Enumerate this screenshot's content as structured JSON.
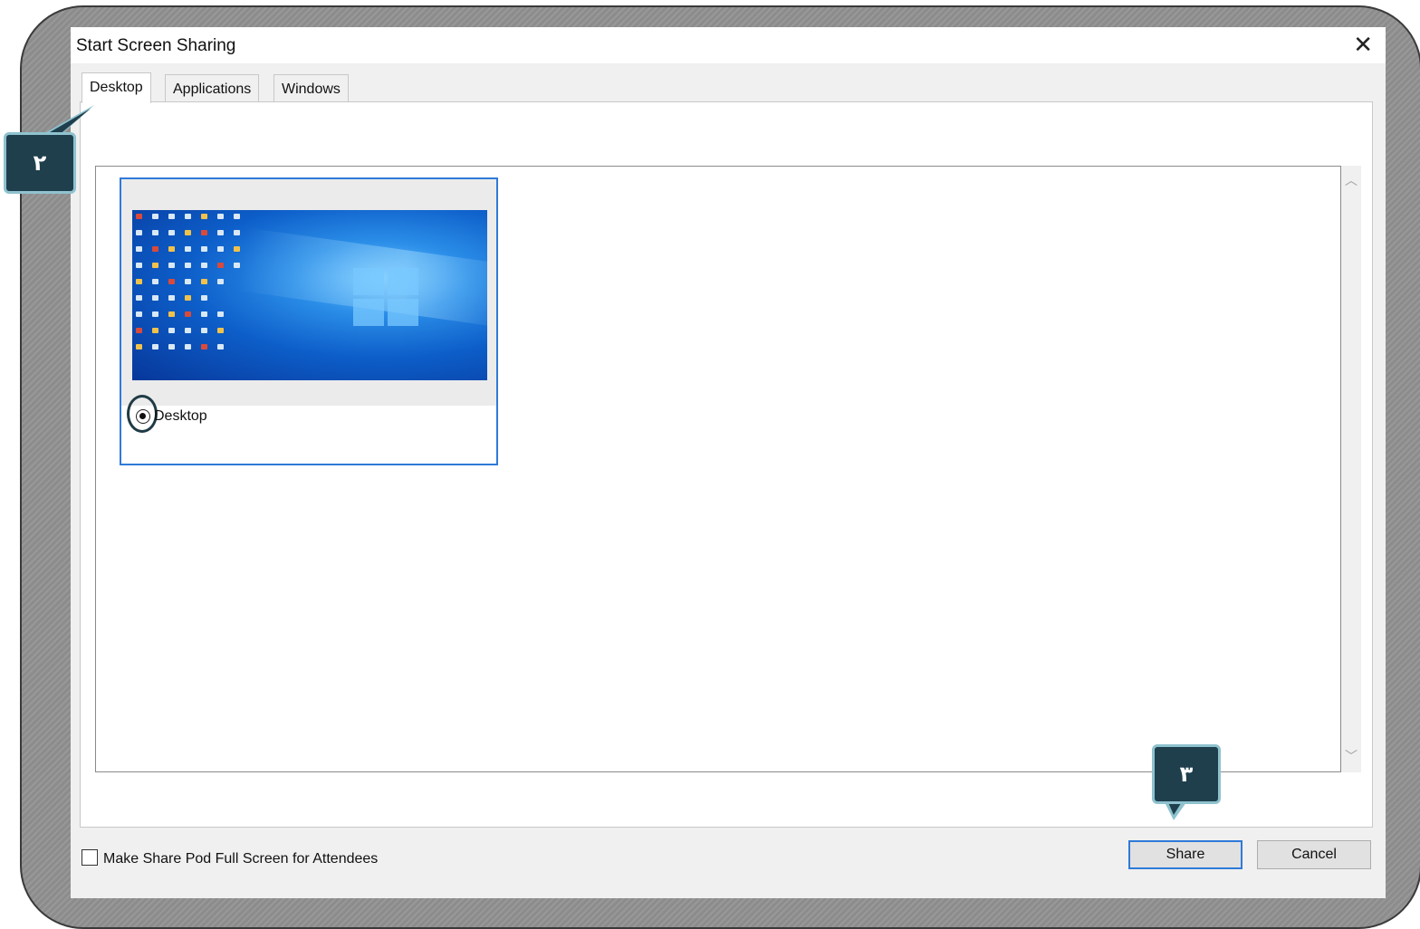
{
  "window": {
    "title": "Start Screen Sharing",
    "close_icon": "close-icon"
  },
  "tabs": [
    {
      "label": "Desktop",
      "active": true
    },
    {
      "label": "Applications",
      "active": false
    },
    {
      "label": "Windows",
      "active": false
    }
  ],
  "desktop_card": {
    "label": "Desktop",
    "selected": true
  },
  "footer": {
    "fullscreen_label": "Make Share Pod Full Screen for Attendees",
    "fullscreen_checked": false,
    "share_label": "Share",
    "cancel_label": "Cancel"
  },
  "annotations": {
    "step_tab": "٢",
    "step_share": "٣"
  },
  "colors": {
    "accent": "#2f7ad9",
    "callout_bg": "#1f3f4d",
    "callout_border": "#8fc2cf",
    "frame": "#8c8c8c"
  }
}
